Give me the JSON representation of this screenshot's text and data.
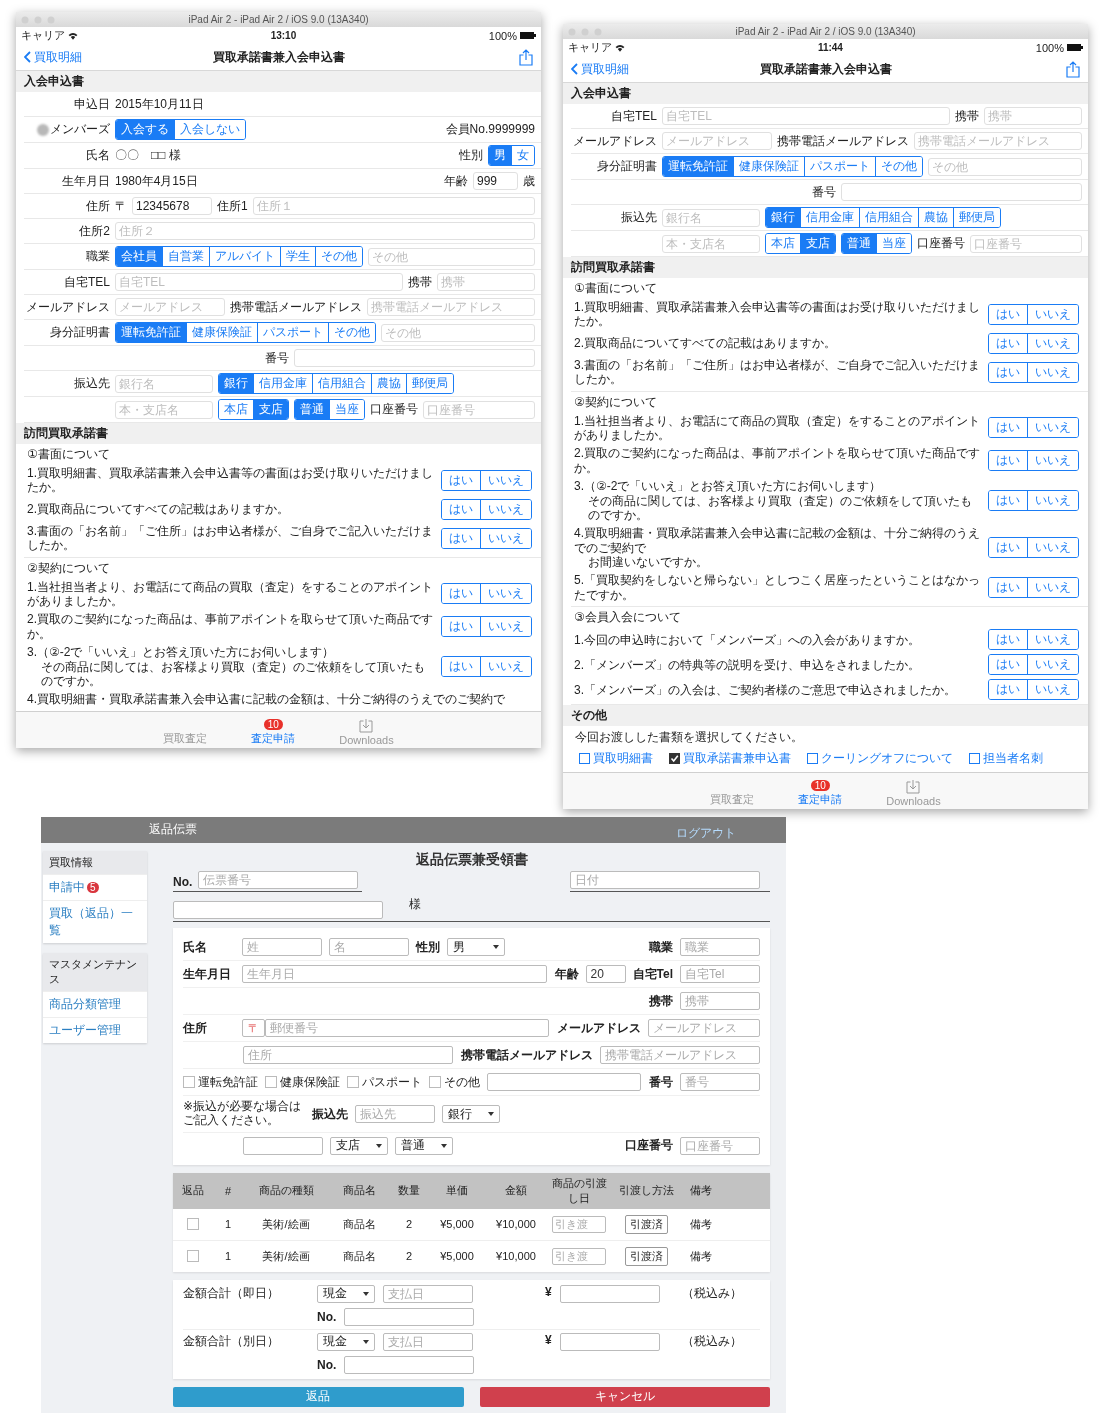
{
  "devices": [
    {
      "sim_title": "iPad Air 2 - iPad Air 2 / iOS 9.0 (13A340)",
      "status": {
        "carrier": "キャリア",
        "time": "13:10",
        "battery": "100%"
      },
      "nav": {
        "back": "買取明細",
        "title": "買取承諾書兼入会申込書"
      },
      "sections": [
        {
          "kind": "form",
          "title": "入会申込書",
          "lines": [
            {
              "items": [
                {
                  "kind": "label",
                  "text": "申込日"
                },
                {
                  "kind": "value",
                  "text": "2015年10月11日"
                }
              ]
            },
            {
              "items": [
                {
                  "kind": "label",
                  "text": "メンバーズ",
                  "redacted": true
                },
                {
                  "kind": "segmented",
                  "options": [
                    {
                      "label": "入会する",
                      "selected": true
                    },
                    {
                      "label": "入会しない",
                      "selected": false
                    }
                  ]
                }
              ],
              "right": [
                {
                  "kind": "value",
                  "text": "会員No.9999999"
                }
              ]
            },
            {
              "items": [
                {
                  "kind": "label",
                  "text": "氏名"
                },
                {
                  "kind": "value",
                  "text": "〇〇　□□ 様"
                }
              ],
              "right": [
                {
                  "kind": "label",
                  "text": "性別"
                },
                {
                  "kind": "segmented",
                  "options": [
                    {
                      "label": "男",
                      "selected": true
                    },
                    {
                      "label": "女",
                      "selected": false
                    }
                  ]
                }
              ]
            },
            {
              "items": [
                {
                  "kind": "label",
                  "text": "生年月日"
                },
                {
                  "kind": "value",
                  "text": "1980年4月15日"
                }
              ],
              "right": [
                {
                  "kind": "label",
                  "text": "年齢"
                },
                {
                  "kind": "field",
                  "value": "999"
                },
                {
                  "kind": "value",
                  "text": "歳"
                }
              ]
            },
            {
              "items": [
                {
                  "kind": "label",
                  "text": "住所"
                },
                {
                  "kind": "value",
                  "text": "〒"
                },
                {
                  "kind": "field",
                  "value": "12345678"
                },
                {
                  "kind": "label",
                  "text": "住所1"
                },
                {
                  "kind": "field",
                  "placeholder": "住所１"
                }
              ]
            },
            {
              "items": [
                {
                  "kind": "label",
                  "text": "住所2"
                },
                {
                  "kind": "field",
                  "placeholder": "住所２"
                }
              ]
            },
            {
              "items": [
                {
                  "kind": "label",
                  "text": "職業"
                },
                {
                  "kind": "segmented",
                  "options": [
                    {
                      "label": "会社員",
                      "selected": true
                    },
                    {
                      "label": "自営業",
                      "selected": false
                    },
                    {
                      "label": "アルバイト",
                      "selected": false
                    },
                    {
                      "label": "学生",
                      "selected": false
                    },
                    {
                      "label": "その他",
                      "selected": false
                    }
                  ]
                },
                {
                  "kind": "field",
                  "placeholder": "その他"
                }
              ]
            },
            {
              "items": [
                {
                  "kind": "label",
                  "text": "自宅TEL"
                },
                {
                  "kind": "field",
                  "placeholder": "自宅TEL"
                }
              ],
              "right": [
                {
                  "kind": "label",
                  "text": "携帯"
                },
                {
                  "kind": "field",
                  "placeholder": "携帯"
                }
              ]
            },
            {
              "items": [
                {
                  "kind": "label",
                  "text": "メールアドレス"
                },
                {
                  "kind": "field",
                  "placeholder": "メールアドレス"
                },
                {
                  "kind": "label",
                  "text": "携帯電話メールアドレス"
                },
                {
                  "kind": "field",
                  "placeholder": "携帯電話メールアドレス"
                }
              ]
            },
            {
              "items": [
                {
                  "kind": "label",
                  "text": "身分証明書"
                },
                {
                  "kind": "segmented",
                  "options": [
                    {
                      "label": "運転免許証",
                      "selected": true
                    },
                    {
                      "label": "健康保険証",
                      "selected": false
                    },
                    {
                      "label": "パスポート",
                      "selected": false
                    },
                    {
                      "label": "その他",
                      "selected": false
                    }
                  ]
                },
                {
                  "kind": "field",
                  "placeholder": "その他"
                }
              ]
            },
            {
              "right": [
                {
                  "kind": "label",
                  "text": "番号"
                },
                {
                  "kind": "field"
                }
              ]
            },
            {
              "items": [
                {
                  "kind": "label",
                  "text": "振込先"
                },
                {
                  "kind": "field",
                  "placeholder": "銀行名"
                },
                {
                  "kind": "segmented",
                  "options": [
                    {
                      "label": "銀行",
                      "selected": true
                    },
                    {
                      "label": "信用金庫",
                      "selected": false
                    },
                    {
                      "label": "信用組合",
                      "selected": false
                    },
                    {
                      "label": "農協",
                      "selected": false
                    },
                    {
                      "label": "郵便局",
                      "selected": false
                    }
                  ]
                }
              ]
            },
            {
              "items": [
                {
                  "kind": "field",
                  "placeholder": "本・支店名"
                },
                {
                  "kind": "segmented",
                  "options": [
                    {
                      "label": "本店",
                      "selected": false
                    },
                    {
                      "label": "支店",
                      "selected": true
                    }
                  ]
                },
                {
                  "kind": "segmented",
                  "options": [
                    {
                      "label": "普通",
                      "selected": true
                    },
                    {
                      "label": "当座",
                      "selected": false
                    }
                  ]
                },
                {
                  "kind": "label",
                  "text": "口座番号"
                },
                {
                  "kind": "field",
                  "placeholder": "口座番号"
                }
              ]
            }
          ]
        },
        {
          "kind": "questions",
          "title": "訪問買取承諾書",
          "groups": [
            {
              "title": "①書面について",
              "questions": [
                {
                  "text": "1.買取明細書、買取承諾書兼入会申込書等の書面はお受け取りいただけましたか。",
                  "options": [
                    {
                      "label": "はい",
                      "selected": false
                    },
                    {
                      "label": "いいえ",
                      "selected": false
                    }
                  ]
                },
                {
                  "text": "2.買取商品についてすべての記載はありますか。",
                  "options": [
                    {
                      "label": "はい",
                      "selected": false
                    },
                    {
                      "label": "いいえ",
                      "selected": false
                    }
                  ]
                },
                {
                  "text": "3.書面の「お名前」「ご住所」はお申込者様が、ご自身でご記入いただけましたか。",
                  "options": [
                    {
                      "label": "はい",
                      "selected": false
                    },
                    {
                      "label": "いいえ",
                      "selected": false
                    }
                  ]
                }
              ]
            },
            {
              "title": "②契約について",
              "questions": [
                {
                  "text": "1.当社担当者より、お電話にて商品の買取（査定）をすることのアポイントがありましたか。",
                  "options": [
                    {
                      "label": "はい",
                      "selected": false
                    },
                    {
                      "label": "いいえ",
                      "selected": false
                    }
                  ]
                },
                {
                  "text": "2.買取のご契約になった商品は、事前アポイントを取らせて頂いた商品ですか。",
                  "options": [
                    {
                      "label": "はい",
                      "selected": false
                    },
                    {
                      "label": "いいえ",
                      "selected": false
                    }
                  ]
                },
                {
                  "text": "3.（②-2で「いいえ」とお答え頂いた方にお伺いします）",
                  "continuation": "その商品に関しては、お客様より買取（査定）のご依頼をして頂いたものですか。",
                  "options": [
                    {
                      "label": "はい",
                      "selected": false
                    },
                    {
                      "label": "いいえ",
                      "selected": false
                    }
                  ]
                },
                {
                  "text": "4.買取明細書・買取承諾書兼入会申込書に記載の金額は、十分ご納得のうえでのご契約で"
                }
              ]
            }
          ]
        }
      ],
      "tabs": [
        {
          "label": "買取査定",
          "selected": false
        },
        {
          "label": "査定申請",
          "selected": true,
          "badge": "10"
        },
        {
          "label": "Downloads",
          "selected": false
        }
      ]
    },
    {
      "sim_title": "iPad Air 2 - iPad Air 2 / iOS 9.0 (13A340)",
      "status": {
        "carrier": "キャリア",
        "time": "11:44",
        "battery": "100%"
      },
      "nav": {
        "back": "買取明細",
        "title": "買取承諾書兼入会申込書"
      },
      "sections": [
        {
          "kind": "form",
          "title": "入会申込書",
          "lines": [
            {
              "items": [
                {
                  "kind": "label",
                  "text": "自宅TEL"
                },
                {
                  "kind": "field",
                  "placeholder": "自宅TEL"
                }
              ],
              "right": [
                {
                  "kind": "label",
                  "text": "携帯"
                },
                {
                  "kind": "field",
                  "placeholder": "携帯"
                }
              ]
            },
            {
              "items": [
                {
                  "kind": "label",
                  "text": "メールアドレス"
                },
                {
                  "kind": "field",
                  "placeholder": "メールアドレス"
                },
                {
                  "kind": "label",
                  "text": "携帯電話メールアドレス"
                },
                {
                  "kind": "field",
                  "placeholder": "携帯電話メールアドレス"
                }
              ]
            },
            {
              "items": [
                {
                  "kind": "label",
                  "text": "身分証明書"
                },
                {
                  "kind": "segmented",
                  "options": [
                    {
                      "label": "運転免許証",
                      "selected": true
                    },
                    {
                      "label": "健康保険証",
                      "selected": false
                    },
                    {
                      "label": "パスポート",
                      "selected": false
                    },
                    {
                      "label": "その他",
                      "selected": false
                    }
                  ]
                },
                {
                  "kind": "field",
                  "placeholder": "その他"
                }
              ]
            },
            {
              "right": [
                {
                  "kind": "label",
                  "text": "番号"
                },
                {
                  "kind": "field"
                }
              ]
            },
            {
              "items": [
                {
                  "kind": "label",
                  "text": "振込先"
                },
                {
                  "kind": "field",
                  "placeholder": "銀行名"
                },
                {
                  "kind": "segmented",
                  "options": [
                    {
                      "label": "銀行",
                      "selected": true
                    },
                    {
                      "label": "信用金庫",
                      "selected": false
                    },
                    {
                      "label": "信用組合",
                      "selected": false
                    },
                    {
                      "label": "農協",
                      "selected": false
                    },
                    {
                      "label": "郵便局",
                      "selected": false
                    }
                  ]
                }
              ]
            },
            {
              "items": [
                {
                  "kind": "field",
                  "placeholder": "本・支店名"
                },
                {
                  "kind": "segmented",
                  "options": [
                    {
                      "label": "本店",
                      "selected": false
                    },
                    {
                      "label": "支店",
                      "selected": true
                    }
                  ]
                },
                {
                  "kind": "segmented",
                  "options": [
                    {
                      "label": "普通",
                      "selected": true
                    },
                    {
                      "label": "当座",
                      "selected": false
                    }
                  ]
                },
                {
                  "kind": "label",
                  "text": "口座番号"
                },
                {
                  "kind": "field",
                  "placeholder": "口座番号"
                }
              ]
            }
          ]
        },
        {
          "kind": "questions",
          "title": "訪問買取承諾書",
          "groups": [
            {
              "title": "①書面について",
              "questions": [
                {
                  "text": "1.買取明細書、買取承諾書兼入会申込書等の書面はお受け取りいただけましたか。",
                  "options": [
                    {
                      "label": "はい",
                      "selected": false
                    },
                    {
                      "label": "いいえ",
                      "selected": false
                    }
                  ]
                },
                {
                  "text": "2.買取商品についてすべての記載はありますか。",
                  "options": [
                    {
                      "label": "はい",
                      "selected": false
                    },
                    {
                      "label": "いいえ",
                      "selected": false
                    }
                  ]
                },
                {
                  "text": "3.書面の「お名前」「ご住所」はお申込者様が、ご自身でご記入いただけましたか。",
                  "options": [
                    {
                      "label": "はい",
                      "selected": false
                    },
                    {
                      "label": "いいえ",
                      "selected": false
                    }
                  ]
                }
              ]
            },
            {
              "title": "②契約について",
              "questions": [
                {
                  "text": "1.当社担当者より、お電話にて商品の買取（査定）をすることのアポイントがありましたか。",
                  "options": [
                    {
                      "label": "はい",
                      "selected": false
                    },
                    {
                      "label": "いいえ",
                      "selected": false
                    }
                  ]
                },
                {
                  "text": "2.買取のご契約になった商品は、事前アポイントを取らせて頂いた商品ですか。",
                  "options": [
                    {
                      "label": "はい",
                      "selected": false
                    },
                    {
                      "label": "いいえ",
                      "selected": false
                    }
                  ]
                },
                {
                  "text": "3.（②-2で「いいえ」とお答え頂いた方にお伺いします）",
                  "continuation": "その商品に関しては、お客様より買取（査定）のご依頼をして頂いたものですか。",
                  "options": [
                    {
                      "label": "はい",
                      "selected": false
                    },
                    {
                      "label": "いいえ",
                      "selected": false
                    }
                  ]
                },
                {
                  "text": "4.買取明細書・買取承諾書兼入会申込書に記載の金額は、十分ご納得のうえでのご契約で",
                  "continuation": "お間違いないですか。",
                  "options": [
                    {
                      "label": "はい",
                      "selected": false
                    },
                    {
                      "label": "いいえ",
                      "selected": false
                    }
                  ]
                },
                {
                  "text": "5.「買取契約をしないと帰らない」としつこく居座ったということはなかったですか。",
                  "options": [
                    {
                      "label": "はい",
                      "selected": false
                    },
                    {
                      "label": "いいえ",
                      "selected": false
                    }
                  ]
                }
              ]
            },
            {
              "title": "③会員入会について",
              "questions": [
                {
                  "text": "1.今回の申込時において「メンバーズ」への入会がありますか。",
                  "options": [
                    {
                      "label": "はい",
                      "selected": false
                    },
                    {
                      "label": "いいえ",
                      "selected": false
                    }
                  ]
                },
                {
                  "text": "2.「メンバーズ」の特典等の説明を受け、申込をされましたか。",
                  "options": [
                    {
                      "label": "はい",
                      "selected": false
                    },
                    {
                      "label": "いいえ",
                      "selected": false
                    }
                  ]
                },
                {
                  "text": "3.「メンバーズ」の入会は、ご契約者様のご意思で申込されましたか。",
                  "options": [
                    {
                      "label": "はい",
                      "selected": false
                    },
                    {
                      "label": "いいえ",
                      "selected": false
                    }
                  ]
                }
              ]
            }
          ]
        },
        {
          "kind": "documents",
          "title": "その他",
          "text": "今回お渡しした書類を選択してください。",
          "checkboxes": [
            {
              "label": "買取明細書",
              "checked": false
            },
            {
              "label": "買取承諾書兼申込書",
              "checked": true
            },
            {
              "label": "クーリングオフについて",
              "checked": false
            },
            {
              "label": "担当者名刺",
              "checked": false
            }
          ]
        }
      ],
      "tabs": [
        {
          "label": "買取査定",
          "selected": false
        },
        {
          "label": "査定申請",
          "selected": true,
          "badge": "10"
        },
        {
          "label": "Downloads",
          "selected": false
        }
      ]
    }
  ],
  "web": {
    "header": {
      "title": "返品伝票",
      "logout": "ログアウト"
    },
    "sidebar": [
      {
        "title": "買取情報",
        "items": [
          {
            "label": "申請中",
            "badge": "5"
          },
          {
            "label": "買取（返品）一覧"
          }
        ]
      },
      {
        "title": "マスタメンテナンス",
        "items": [
          {
            "label": "商品分類管理"
          },
          {
            "label": "ユーザー管理"
          }
        ]
      }
    ],
    "title": "返品伝票兼受領書",
    "no_label": "No.",
    "slip": {
      "placeholder": "伝票番号"
    },
    "date": {
      "placeholder": "日付"
    },
    "customer_suffix": "様",
    "form_lines": [
      {
        "items": [
          {
            "kind": "label",
            "text": "氏名"
          },
          {
            "kind": "field",
            "placeholder": "姓"
          },
          {
            "kind": "field",
            "placeholder": "名"
          },
          {
            "kind": "label",
            "text": "性別"
          },
          {
            "kind": "select",
            "value": "男"
          }
        ],
        "right": [
          {
            "kind": "label",
            "text": "職業"
          },
          {
            "kind": "field",
            "placeholder": "職業"
          }
        ]
      },
      {
        "items": [
          {
            "kind": "label",
            "text": "生年月日"
          },
          {
            "kind": "field",
            "placeholder": "生年月日"
          }
        ],
        "right": [
          {
            "kind": "label",
            "text": "年齢"
          },
          {
            "kind": "field",
            "value": "20"
          },
          {
            "kind": "label",
            "text": "自宅Tel"
          },
          {
            "kind": "field",
            "placeholder": "自宅Tel"
          }
        ]
      },
      {
        "right": [
          {
            "kind": "label",
            "text": "携帯"
          },
          {
            "kind": "field",
            "placeholder": "携帯"
          }
        ]
      },
      {
        "items": [
          {
            "kind": "label",
            "text": "住所"
          },
          {
            "kind": "postal",
            "mark": "〒",
            "placeholder": "郵便番号"
          }
        ],
        "right": [
          {
            "kind": "label",
            "text": "メールアドレス"
          },
          {
            "kind": "field",
            "placeholder": "メールアドレス"
          }
        ]
      },
      {
        "items": [
          {
            "kind": "field",
            "placeholder": "住所"
          }
        ],
        "right": [
          {
            "kind": "label",
            "text": "携帯電話メールアドレス"
          },
          {
            "kind": "field",
            "placeholder": "携帯電話メールアドレス"
          }
        ]
      },
      {
        "items": [
          {
            "kind": "check",
            "label": "運転免許証",
            "checked": false
          },
          {
            "kind": "check",
            "label": "健康保険証",
            "checked": false
          },
          {
            "kind": "check",
            "label": "パスポート",
            "checked": false
          },
          {
            "kind": "check",
            "label": "その他",
            "checked": false
          },
          {
            "kind": "field"
          }
        ],
        "right": [
          {
            "kind": "label",
            "text": "番号"
          },
          {
            "kind": "field",
            "placeholder": "番号"
          }
        ]
      },
      {
        "items": [
          {
            "kind": "note",
            "text": "※振込が必要な場合はご記入ください。"
          },
          {
            "kind": "label",
            "text": "振込先"
          },
          {
            "kind": "field",
            "placeholder": "振込先"
          },
          {
            "kind": "select",
            "value": "銀行"
          }
        ]
      },
      {
        "items": [
          {
            "kind": "field"
          },
          {
            "kind": "select",
            "value": "支店"
          },
          {
            "kind": "select",
            "value": "普通"
          }
        ],
        "right": [
          {
            "kind": "label",
            "text": "口座番号"
          },
          {
            "kind": "field",
            "placeholder": "口座番号"
          }
        ]
      }
    ],
    "table": {
      "columns": [
        "返品",
        "#",
        "商品の種類",
        "商品名",
        "数量",
        "単価",
        "金額",
        "商品の引渡し日",
        "引渡し方法",
        "備考"
      ],
      "rows": [
        {
          "cells": [
            {
              "kind": "check",
              "checked": false
            },
            {
              "kind": "text",
              "text": "1"
            },
            {
              "kind": "text",
              "text": "美術/絵画"
            },
            {
              "kind": "text",
              "text": "商品名"
            },
            {
              "kind": "text",
              "text": "2"
            },
            {
              "kind": "text",
              "text": "¥5,000"
            },
            {
              "kind": "text",
              "text": "¥10,000"
            },
            {
              "kind": "field",
              "placeholder": "引き渡"
            },
            {
              "kind": "button",
              "text": "引渡済"
            },
            {
              "kind": "text",
              "text": "備考"
            }
          ]
        },
        {
          "cells": [
            {
              "kind": "check",
              "checked": false
            },
            {
              "kind": "text",
              "text": "1"
            },
            {
              "kind": "text",
              "text": "美術/絵画"
            },
            {
              "kind": "text",
              "text": "商品名"
            },
            {
              "kind": "text",
              "text": "2"
            },
            {
              "kind": "text",
              "text": "¥5,000"
            },
            {
              "kind": "text",
              "text": "¥10,000"
            },
            {
              "kind": "field",
              "placeholder": "引き渡"
            },
            {
              "kind": "button",
              "text": "引渡済"
            },
            {
              "kind": "text",
              "text": "備考"
            }
          ]
        }
      ]
    },
    "totals": [
      {
        "label": "金額合計（即日）",
        "method": "現金",
        "date_placeholder": "支払日",
        "no_label": "No.",
        "yen": "¥",
        "tax": "（税込み）"
      },
      {
        "label": "金額合計（別日）",
        "method": "現金",
        "date_placeholder": "支払日",
        "no_label": "No.",
        "yen": "¥",
        "tax": "（税込み）"
      }
    ],
    "buttons": [
      {
        "label": "返品",
        "kind": "primary"
      },
      {
        "label": "キャンセル",
        "kind": "danger"
      }
    ]
  }
}
